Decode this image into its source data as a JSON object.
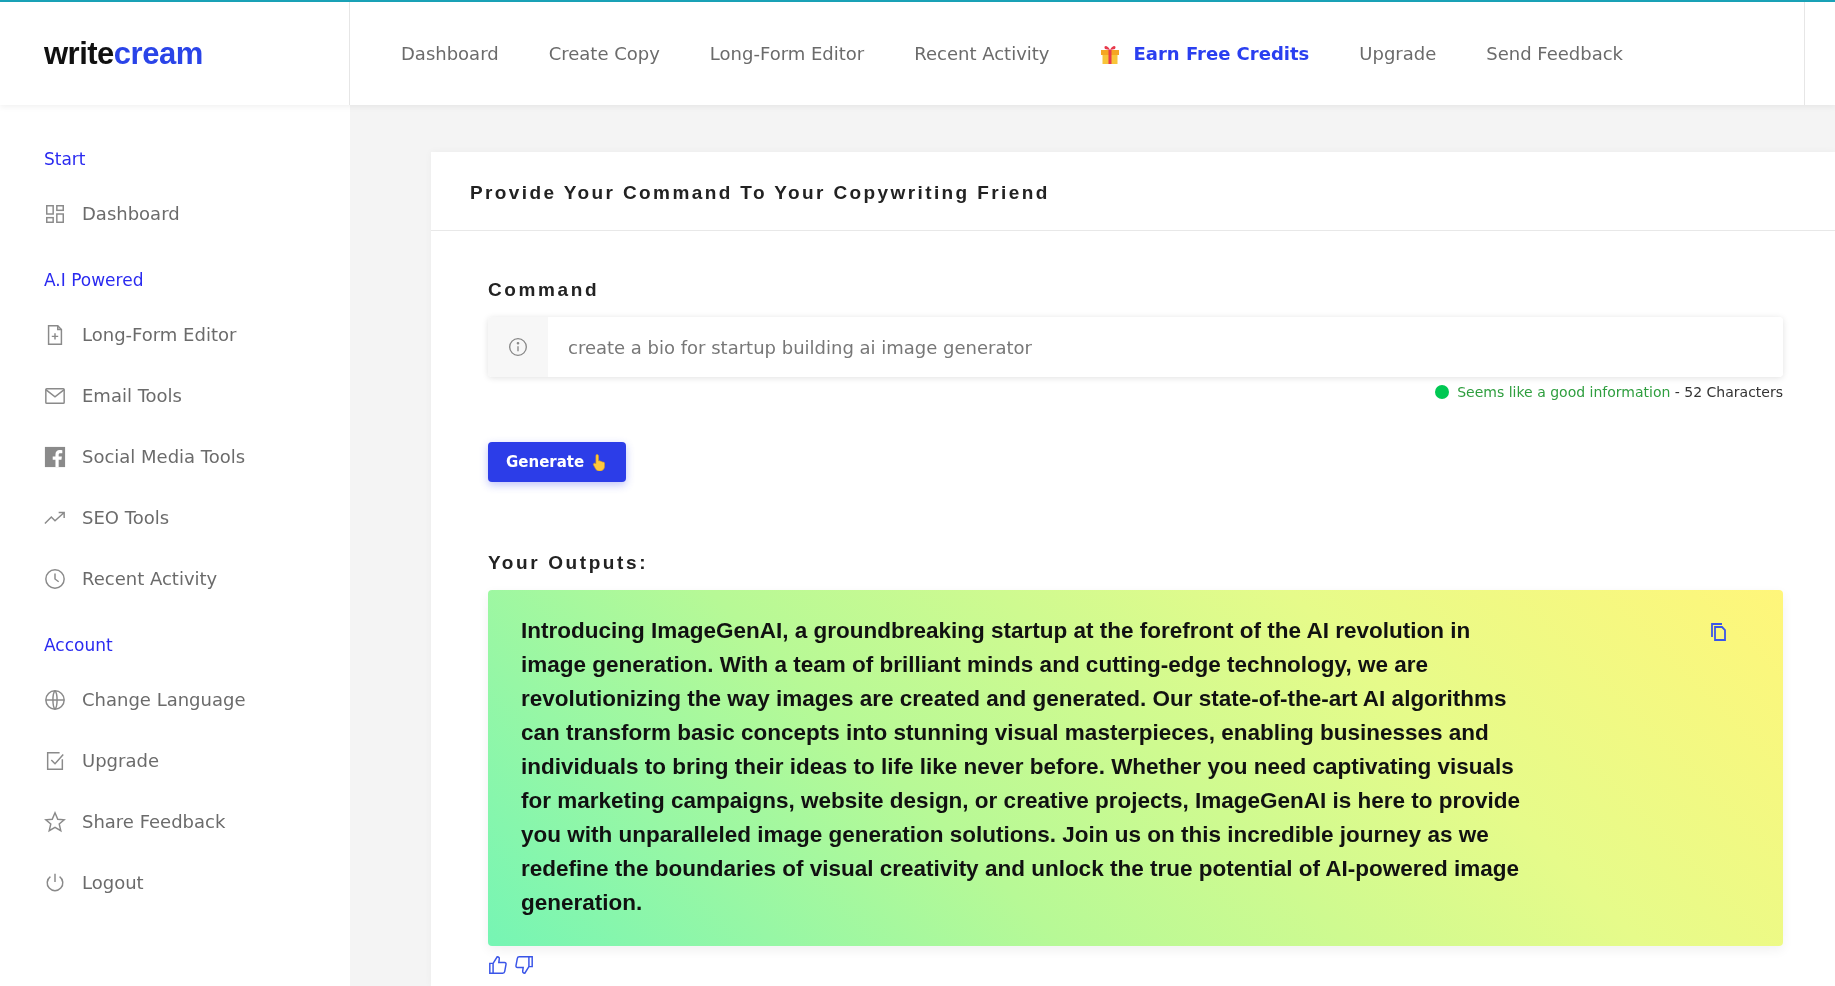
{
  "logo": {
    "dark": "write",
    "accent": "cream"
  },
  "nav": [
    {
      "label": "Dashboard",
      "kind": "plain"
    },
    {
      "label": "Create Copy",
      "kind": "plain"
    },
    {
      "label": "Long-Form Editor",
      "kind": "plain"
    },
    {
      "label": "Recent Activity",
      "kind": "plain"
    },
    {
      "label": "Earn Free Credits",
      "kind": "promo"
    },
    {
      "label": "Upgrade",
      "kind": "plain"
    },
    {
      "label": "Send Feedback",
      "kind": "plain"
    }
  ],
  "sidebar": [
    {
      "title": "Start",
      "items": [
        {
          "label": "Dashboard",
          "kind": "grid"
        }
      ]
    },
    {
      "title": "A.I Powered",
      "items": [
        {
          "label": "Long-Form Editor",
          "kind": "doc"
        },
        {
          "label": "Email Tools",
          "kind": "mail"
        },
        {
          "label": "Social Media Tools",
          "kind": "facebook"
        },
        {
          "label": "SEO Tools",
          "kind": "trend"
        },
        {
          "label": "Recent Activity",
          "kind": "clock"
        }
      ]
    },
    {
      "title": "Account",
      "items": [
        {
          "label": "Change Language",
          "kind": "globe"
        },
        {
          "label": "Upgrade",
          "kind": "check"
        },
        {
          "label": "Share Feedback",
          "kind": "star"
        },
        {
          "label": "Logout",
          "kind": "power"
        }
      ]
    }
  ],
  "card": {
    "title": "Provide Your Command To Your Copywriting Friend",
    "command_label": "Command",
    "command_value": "create a bio for startup building ai image generator",
    "status": {
      "color": "#00c853",
      "message": "Seems like a good information",
      "separator": " - ",
      "count": "52 Characters"
    },
    "generate_button": "Generate",
    "outputs_label": "Your Outputs:",
    "output_text": "Introducing ImageGenAI, a groundbreaking startup at the forefront of the AI revolution in image generation. With a team of brilliant minds and cutting-edge technology, we are revolutionizing the way images are created and generated. Our state-of-the-art AI algorithms can transform basic concepts into stunning visual masterpieces, enabling businesses and individuals to bring their ideas to life like never before. Whether you need captivating visuals for marketing campaigns, website design, or creative projects, ImageGenAI is here to provide you with unparalleled image generation solutions. Join us on this incredible journey as we redefine the boundaries of visual creativity and unlock the true potential of AI-powered image generation."
  }
}
